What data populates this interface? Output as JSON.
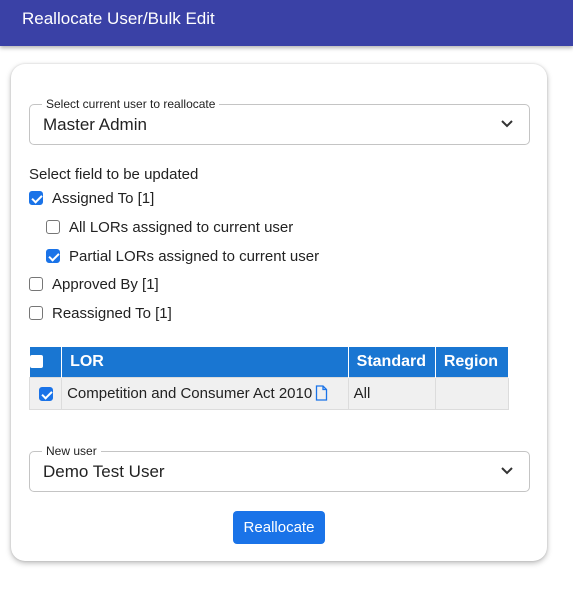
{
  "header": {
    "title": "Reallocate User/Bulk Edit"
  },
  "current_user_select": {
    "legend": "Select current user to reallocate",
    "value": "Master Admin"
  },
  "field_section": {
    "label": "Select field to be updated",
    "options": [
      {
        "label": "Assigned To [1]",
        "checked": true
      },
      {
        "label": "All LORs assigned to current user",
        "checked": false
      },
      {
        "label": "Partial LORs assigned to current user",
        "checked": true
      },
      {
        "label": "Approved By [1]",
        "checked": false
      },
      {
        "label": "Reassigned To [1]",
        "checked": false
      }
    ]
  },
  "table": {
    "columns": [
      "LOR",
      "Standard",
      "Region"
    ],
    "rows": [
      {
        "checked": true,
        "lor": "Competition and Consumer Act 2010",
        "standard": "All",
        "region": ""
      }
    ]
  },
  "new_user_select": {
    "legend": "New user",
    "value": "Demo Test User"
  },
  "actions": {
    "reallocate_label": "Reallocate"
  },
  "colors": {
    "header_bg": "#3a41a6",
    "table_header_bg": "#1976d2",
    "primary": "#1a73e8"
  },
  "icons": {
    "dropdown": "chevron-down-icon",
    "document": "document-icon"
  }
}
